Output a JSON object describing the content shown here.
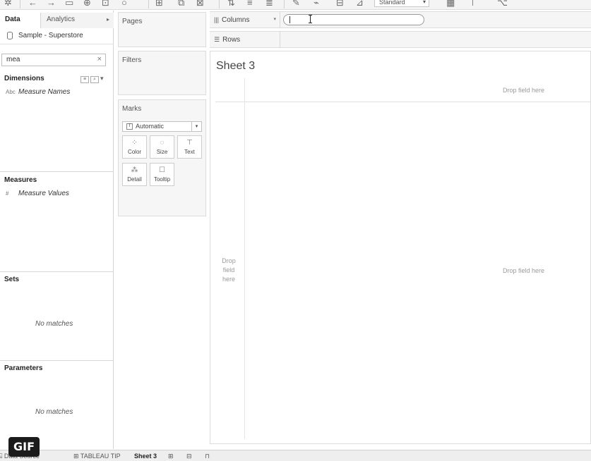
{
  "toolbar": {
    "view_select": "Standard"
  },
  "data_pane": {
    "tabs": {
      "data": "Data",
      "analytics": "Analytics"
    },
    "datasource": "Sample - Superstore",
    "search_value": "mea",
    "sections": {
      "dimensions": {
        "title": "Dimensions",
        "field": "Measure Names",
        "field_icon": "Abc"
      },
      "measures": {
        "title": "Measures",
        "field": "Measure Values",
        "field_icon": "#"
      },
      "sets": {
        "title": "Sets",
        "empty": "No matches"
      },
      "parameters": {
        "title": "Parameters",
        "empty": "No matches"
      }
    }
  },
  "cards": {
    "pages": "Pages",
    "filters": "Filters",
    "marks": {
      "title": "Marks",
      "mark_type": "Automatic",
      "buttons": {
        "color": "Color",
        "size": "Size",
        "text": "Text",
        "detail": "Detail",
        "tooltip": "Tooltip"
      }
    }
  },
  "shelves": {
    "columns": "Columns",
    "rows": "Rows"
  },
  "sheet": {
    "title": "Sheet 3",
    "drop_top": "Drop field here",
    "drop_center": "Drop field here",
    "drop_left": "Drop field here"
  },
  "bottom_tabs": {
    "data_source": "Data Source",
    "tab1": "TABLEAU TIP",
    "tab2": "Sheet 3"
  },
  "badge": "GIF"
}
